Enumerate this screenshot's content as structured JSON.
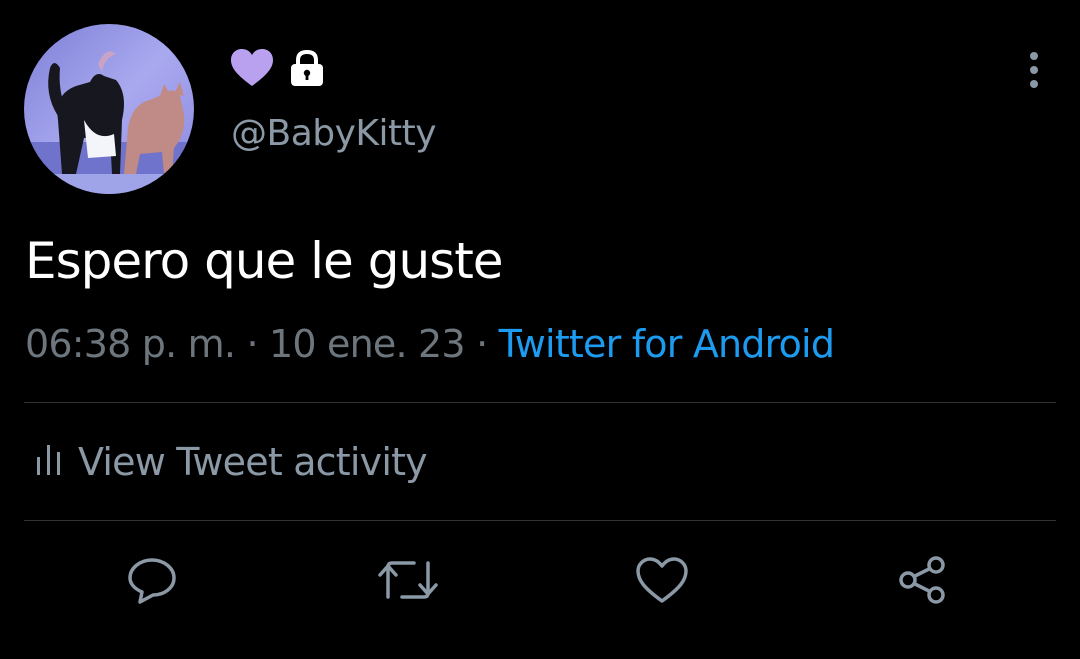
{
  "profile": {
    "handle": "@BabyKitty",
    "avatar_icon": "cats-photo-avatar",
    "badges": [
      {
        "icon": "purple-heart-icon",
        "color": "#b9a1f0"
      },
      {
        "icon": "lock-icon",
        "color": "#ffffff"
      }
    ]
  },
  "tweet": {
    "text": "Espero que le guste",
    "time": "06:38 p. m.",
    "separator": " · ",
    "date": "10 ene. 23",
    "source": "Twitter for Android"
  },
  "activity": {
    "label": "View Tweet activity",
    "icon": "bar-chart-icon"
  },
  "actions": [
    {
      "name": "reply",
      "icon": "reply-icon"
    },
    {
      "name": "retweet",
      "icon": "retweet-icon"
    },
    {
      "name": "like",
      "icon": "heart-outline-icon"
    },
    {
      "name": "share",
      "icon": "share-icon"
    }
  ],
  "colors": {
    "background": "#000000",
    "text": "#ffffff",
    "secondary": "#6e767d",
    "link": "#1d9bf0",
    "divider": "#2f3336",
    "icon": "#8b98a5"
  }
}
